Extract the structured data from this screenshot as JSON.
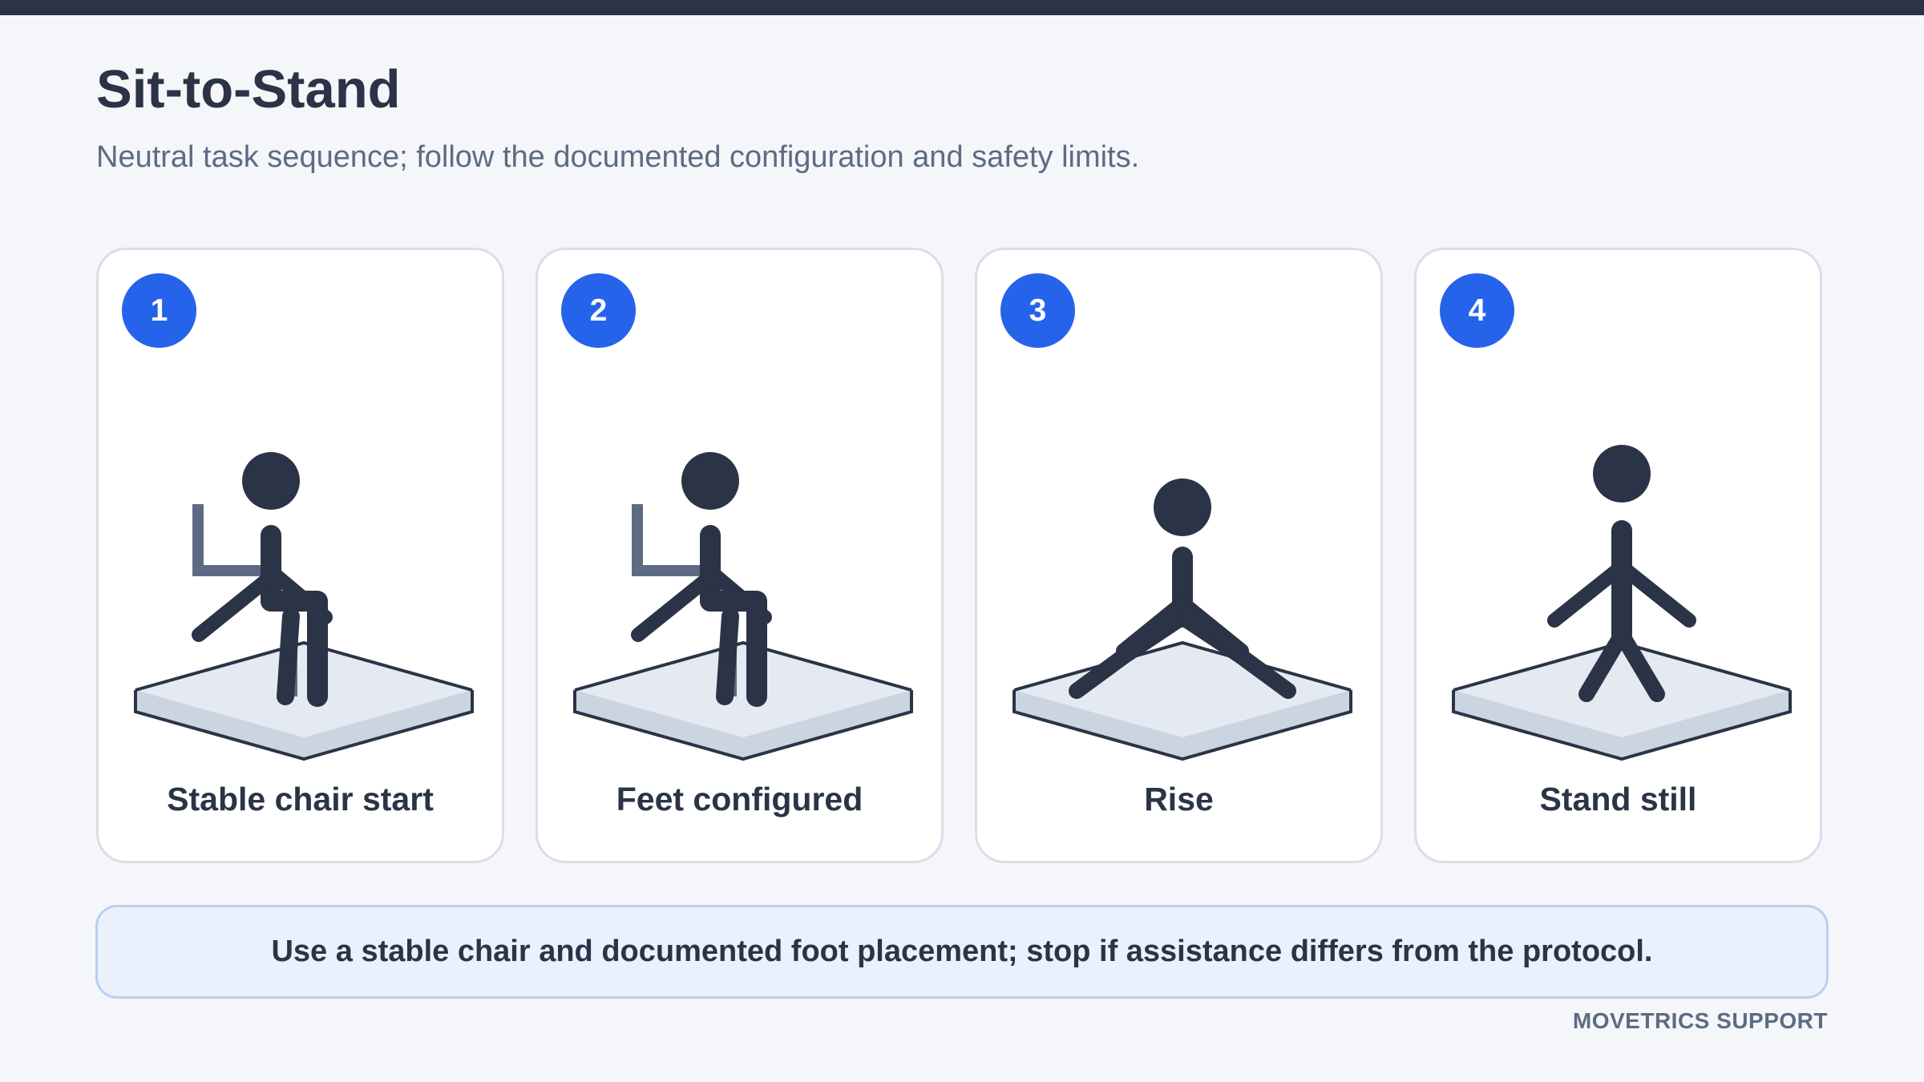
{
  "header": {
    "title": "Sit-to-Stand",
    "subtitle": "Neutral task sequence; follow the documented configuration and safety limits."
  },
  "steps": [
    {
      "number": "1",
      "label": "Stable chair start",
      "figure": "seated-figure-with-chair"
    },
    {
      "number": "2",
      "label": "Feet configured",
      "figure": "seated-figure-feet-placed"
    },
    {
      "number": "3",
      "label": "Rise",
      "figure": "rising-figure"
    },
    {
      "number": "4",
      "label": "Stand still",
      "figure": "standing-figure"
    }
  ],
  "safety_note": "Use a stable chair and documented foot placement; stop if assistance differs from the protocol.",
  "footer": {
    "brand": "MOVETRICS SUPPORT"
  },
  "colors": {
    "dark": "#2b3446",
    "accent_blue": "#2563eb",
    "chair": "#5d6b82",
    "platform_fill": "#cbd5e1",
    "platform_top": "#e5eaf2",
    "note_background": "#eaf1fd",
    "note_border": "#b9cff3"
  }
}
